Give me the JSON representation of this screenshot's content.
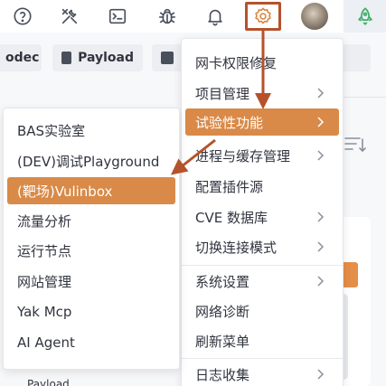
{
  "toolbar": {
    "icons": [
      "help-icon",
      "tools-icon",
      "terminal-icon",
      "bug-icon",
      "bell-icon",
      "gear-icon",
      "avatar",
      "rocket-icon"
    ]
  },
  "tabs": {
    "codec_label": "odec",
    "payload_label": "Payload"
  },
  "menu": {
    "items": [
      {
        "label": "网卡权限修复",
        "has_submenu": false
      },
      {
        "label": "项目管理",
        "has_submenu": true
      },
      {
        "label": "试验性功能",
        "has_submenu": true,
        "active": true
      },
      {
        "label": "进程与缓存管理",
        "has_submenu": true
      },
      {
        "label": "配置插件源",
        "has_submenu": false
      },
      {
        "label": "CVE 数据库",
        "has_submenu": true
      },
      {
        "label": "切换连接模式",
        "has_submenu": true
      },
      {
        "label": "系统设置",
        "has_submenu": true
      },
      {
        "label": "网络诊断",
        "has_submenu": false
      },
      {
        "label": "刷新菜单",
        "has_submenu": false
      },
      {
        "label": "日志收集",
        "has_submenu": true
      }
    ]
  },
  "submenu": {
    "items": [
      {
        "label": "BAS实验室"
      },
      {
        "label": "(DEV)调试Playground"
      },
      {
        "label": "(靶场)Vulinbox",
        "active": true
      },
      {
        "label": "流量分析"
      },
      {
        "label": "运行节点"
      },
      {
        "label": "网站管理"
      },
      {
        "label": "Yak Mcp"
      },
      {
        "label": "AI Agent"
      }
    ]
  },
  "background": {
    "bottom_text": "Payload"
  },
  "colors": {
    "accent": "#d98a48",
    "annotation": "#b5522b",
    "search_button": "#e58e49"
  }
}
